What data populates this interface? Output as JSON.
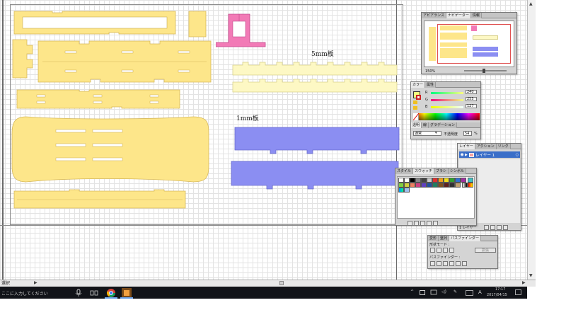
{
  "canvas": {
    "label_5mm": "5mm板",
    "label_1mm": "1mm板"
  },
  "status": {
    "tool_label": "選択"
  },
  "taskbar": {
    "search_placeholder": "ここに入力してください",
    "time": "17:17",
    "date": "2017/04/15",
    "ime": "A"
  },
  "navigator": {
    "tabs": [
      "アピアランス",
      "ナビゲーター",
      "情報"
    ],
    "zoom": "150%"
  },
  "color": {
    "tabs": [
      "カラー",
      "属性"
    ],
    "channels": [
      {
        "name": "R",
        "value": "240"
      },
      {
        "name": "G",
        "value": "255"
      },
      {
        "name": "B",
        "value": "127"
      }
    ],
    "blend_mode": "通常",
    "opacity_label": "不透明度",
    "opacity": "54",
    "opacity_unit": "%"
  },
  "transparency": {
    "tabs": [
      "透明",
      "線",
      "グラデーション"
    ]
  },
  "layers": {
    "tabs": [
      "レイヤー",
      "アクション",
      "リンク"
    ],
    "layer_name": "レイヤー 1",
    "footer_label": "1 レイヤー"
  },
  "swatches": {
    "tabs": [
      "スタイル",
      "スウォッチ",
      "ブラシ",
      "シンボル"
    ]
  },
  "pathfinder": {
    "tabs": [
      "変形",
      "整列",
      "パスファインダー"
    ],
    "shape_mode_label": "形状モード :",
    "pathfinder_label": "パスファインダー :",
    "expand_label": "拡張"
  },
  "colors": {
    "pastel_yellow": "#fde68a",
    "pale_yellow": "#fdf8c4",
    "blue": "#8b8ef2",
    "pink": "#f27ab6"
  }
}
